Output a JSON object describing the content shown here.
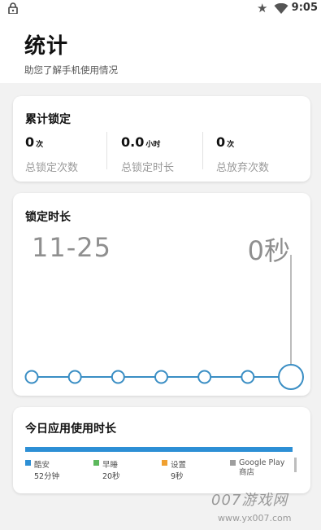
{
  "status_bar": {
    "time": "9:05",
    "icons": [
      "lock-icon",
      "star-icon",
      "wifi-icon"
    ]
  },
  "header": {
    "title": "统计",
    "subtitle": "助您了解手机使用情况"
  },
  "summary": {
    "title": "累计锁定",
    "stats": [
      {
        "value": "0",
        "unit": "次",
        "label": "总锁定次数"
      },
      {
        "value": "0.0",
        "unit": "小时",
        "label": "总锁定时长"
      },
      {
        "value": "0",
        "unit": "次",
        "label": "总放弃次数"
      }
    ]
  },
  "lock_duration": {
    "title": "锁定时长",
    "date": "11-25",
    "value": "0秒",
    "points": 7,
    "selected_index": 6,
    "accent": "#3a8ec4"
  },
  "app_usage": {
    "title": "今日应用使用时长",
    "bar_color": "#2d8fd5",
    "apps": [
      {
        "name": "酷安",
        "time": "52分钟",
        "color": "#2d8fd5"
      },
      {
        "name": "早睡",
        "time": "20秒",
        "color": "#5cb85c"
      },
      {
        "name": "设置",
        "time": "9秒",
        "color": "#f0a030"
      },
      {
        "name": "Google Play 商店",
        "time": "",
        "color": "#9e9e9e"
      }
    ]
  },
  "watermark": {
    "logo": "007游戏网",
    "url": "www.yx007.com"
  }
}
